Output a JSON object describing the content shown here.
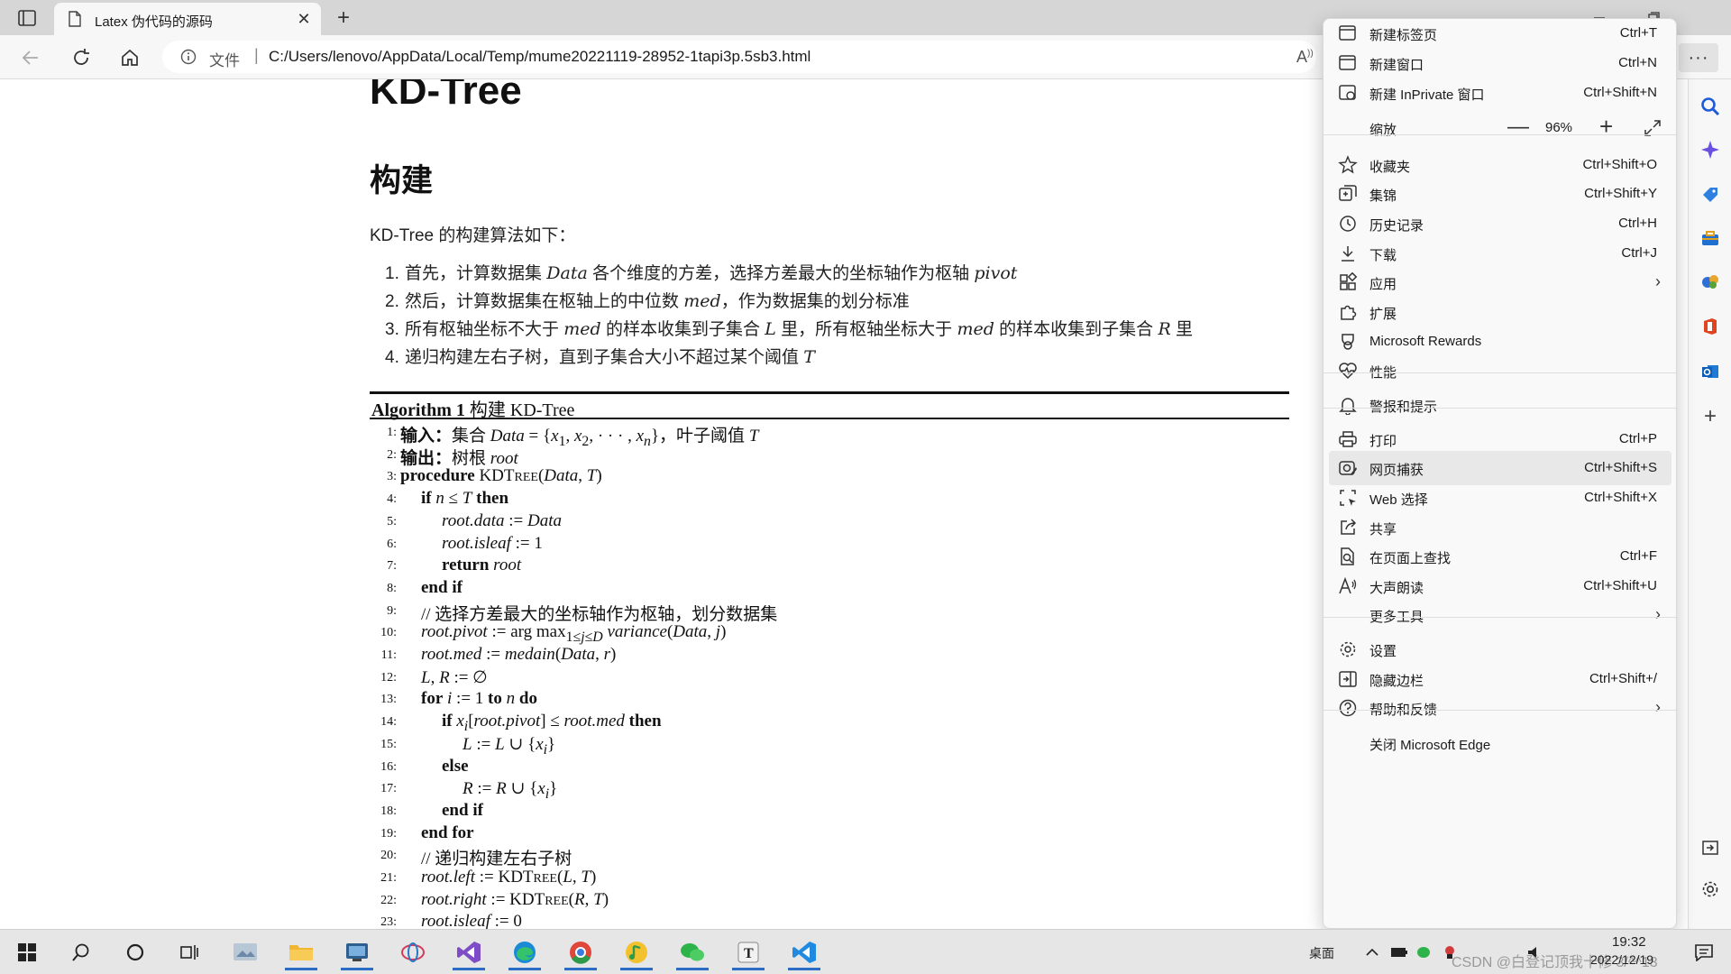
{
  "browser": {
    "tab": {
      "title": "Latex 伪代码的源码"
    },
    "address": {
      "label": "文件",
      "separator": "|",
      "url": "C:/Users/lenovo/AppData/Local/Temp/mume20221119-28952-1tapi3p.5sb3.html"
    },
    "more_label": "···"
  },
  "page": {
    "title": "KD-Tree",
    "section": "构建",
    "intro": "KD-Tree 的构建算法如下：",
    "steps": [
      {
        "num": "1.",
        "parts": [
          "首先，计算数据集 ",
          "Data",
          " 各个维度的方差，选择方差最大的坐标轴作为枢轴 ",
          "pivot",
          ""
        ]
      },
      {
        "num": "2.",
        "parts": [
          "然后，计算数据集在枢轴上的中位数 ",
          "med",
          "，作为数据集的划分标准",
          "",
          ""
        ]
      },
      {
        "num": "3.",
        "parts": [
          "所有枢轴坐标不大于 ",
          "med",
          " 的样本收集到子集合 ",
          "L",
          " 里，所有枢轴坐标大于 ",
          "med",
          " 的样本收集到子集合 ",
          "R",
          " 里"
        ]
      },
      {
        "num": "4.",
        "parts": [
          "递归构建左右子树，直到子集合大小不超过某个阈值 ",
          "T",
          ""
        ]
      }
    ],
    "algorithm": {
      "caption_bold": "Algorithm 1",
      "caption_text": " 构建 KD-Tree",
      "lines": [
        {
          "n": "1:",
          "indent": 0,
          "html": "<span class='kw'>输入：</span>集合 <i>Data</i> = {<i>x</i><sub>1</sub>, <i>x</i><sub>2</sub>, · · · , <i>x</i><sub><i>n</i></sub>}，叶子阈值 <i>T</i>"
        },
        {
          "n": "2:",
          "indent": 0,
          "html": "<span class='kw'>输出：</span>树根 <i>root</i>"
        },
        {
          "n": "3:",
          "indent": 0,
          "html": "<span class='kw'>procedure</span> KDT<span style='font-size:14px'>REE</span>(<i>Data</i>, <i>T</i>)"
        },
        {
          "n": "4:",
          "indent": 1,
          "html": "<span class='kw'>if</span> <i>n</i> ≤ <i>T</i> <span class='kw'>then</span>"
        },
        {
          "n": "5:",
          "indent": 2,
          "html": "<i>root.data</i> := <i>Data</i>"
        },
        {
          "n": "6:",
          "indent": 2,
          "html": "<i>root.isleaf</i> := 1"
        },
        {
          "n": "7:",
          "indent": 2,
          "html": "<span class='kw'>return</span> <i>root</i>"
        },
        {
          "n": "8:",
          "indent": 1,
          "html": "<span class='kw'>end if</span>"
        },
        {
          "n": "9:",
          "indent": 1,
          "html": "// 选择方差最大的坐标轴作为枢轴，划分数据集"
        },
        {
          "n": "10:",
          "indent": 1,
          "html": "<i>root.pivot</i> := arg max<sub>1≤<i>j</i>≤<i>D</i></sub> <i>variance</i>(<i>Data</i>, <i>j</i>)"
        },
        {
          "n": "11:",
          "indent": 1,
          "html": "<i>root.med</i> := <i>medain</i>(<i>Data</i>, <i>r</i>)"
        },
        {
          "n": "12:",
          "indent": 1,
          "html": "<i>L</i>, <i>R</i> := ∅"
        },
        {
          "n": "13:",
          "indent": 1,
          "html": "<span class='kw'>for</span> <i>i</i> := 1 <span class='kw'>to</span> <i>n</i> <span class='kw'>do</span>"
        },
        {
          "n": "14:",
          "indent": 2,
          "html": "<span class='kw'>if</span> <i>x</i><sub><i>i</i></sub>[<i>root.pivot</i>] ≤ <i>root.med</i> <span class='kw'>then</span>"
        },
        {
          "n": "15:",
          "indent": 3,
          "html": "<i>L</i> := <i>L</i> ∪ {<i>x</i><sub><i>i</i></sub>}"
        },
        {
          "n": "16:",
          "indent": 2,
          "html": "<span class='kw'>else</span>"
        },
        {
          "n": "17:",
          "indent": 3,
          "html": "<i>R</i> := <i>R</i> ∪ {<i>x</i><sub><i>i</i></sub>}"
        },
        {
          "n": "18:",
          "indent": 2,
          "html": "<span class='kw'>end if</span>"
        },
        {
          "n": "19:",
          "indent": 1,
          "html": "<span class='kw'>end for</span>"
        },
        {
          "n": "20:",
          "indent": 1,
          "html": "// 递归构建左右子树"
        },
        {
          "n": "21:",
          "indent": 1,
          "html": "<i>root.left</i> := KDT<span style='font-size:14px'>REE</span>(<i>L</i>, <i>T</i>)"
        },
        {
          "n": "22:",
          "indent": 1,
          "html": "<i>root.right</i> := KDT<span style='font-size:14px'>REE</span>(<i>R</i>, <i>T</i>)"
        },
        {
          "n": "23:",
          "indent": 1,
          "html": "<i>root.isleaf</i> := 0"
        }
      ]
    }
  },
  "menu": {
    "items": [
      {
        "name": "new-tab",
        "icon": "newtab-icon",
        "label": "新建标签页",
        "shortcut": "Ctrl+T"
      },
      {
        "name": "new-window",
        "icon": "window-icon",
        "label": "新建窗口",
        "shortcut": "Ctrl+N"
      },
      {
        "name": "new-inprivate",
        "icon": "inprivate-icon",
        "label": "新建 InPrivate 窗口",
        "shortcut": "Ctrl+Shift+N"
      },
      {
        "name": "zoom",
        "label": "缩放",
        "zoom_value": "96%",
        "minus": "—",
        "plus": "+"
      },
      {
        "name": "favorites",
        "icon": "star-icon",
        "label": "收藏夹",
        "shortcut": "Ctrl+Shift+O"
      },
      {
        "name": "collections",
        "icon": "collections-icon",
        "label": "集锦",
        "shortcut": "Ctrl+Shift+Y"
      },
      {
        "name": "history",
        "icon": "history-icon",
        "label": "历史记录",
        "shortcut": "Ctrl+H"
      },
      {
        "name": "downloads",
        "icon": "download-icon",
        "label": "下载",
        "shortcut": "Ctrl+J"
      },
      {
        "name": "apps",
        "icon": "apps-icon",
        "label": "应用",
        "chevron": "›"
      },
      {
        "name": "extensions",
        "icon": "puzzle-icon",
        "label": "扩展"
      },
      {
        "name": "rewards",
        "icon": "rewards-icon",
        "label": "Microsoft Rewards"
      },
      {
        "name": "performance",
        "icon": "heartbeat-icon",
        "label": "性能"
      },
      {
        "name": "alerts",
        "icon": "bell-icon",
        "label": "警报和提示"
      },
      {
        "name": "print",
        "icon": "printer-icon",
        "label": "打印",
        "shortcut": "Ctrl+P"
      },
      {
        "name": "web-capture",
        "icon": "capture-icon",
        "label": "网页捕获",
        "shortcut": "Ctrl+Shift+S"
      },
      {
        "name": "web-select",
        "icon": "select-icon",
        "label": "Web 选择",
        "shortcut": "Ctrl+Shift+X"
      },
      {
        "name": "share",
        "icon": "share-icon",
        "label": "共享"
      },
      {
        "name": "find-on-page",
        "icon": "find-icon",
        "label": "在页面上查找",
        "shortcut": "Ctrl+F"
      },
      {
        "name": "read-aloud",
        "icon": "read-aloud-icon",
        "label": "大声朗读",
        "shortcut": "Ctrl+Shift+U"
      },
      {
        "name": "more-tools",
        "label": "更多工具",
        "chevron": "›"
      },
      {
        "name": "settings",
        "icon": "gear-icon",
        "label": "设置"
      },
      {
        "name": "hide-sidebar",
        "icon": "sidebar-icon",
        "label": "隐藏边栏",
        "shortcut": "Ctrl+Shift+/"
      },
      {
        "name": "help",
        "icon": "help-icon",
        "label": "帮助和反馈",
        "chevron": "›"
      },
      {
        "name": "close-edge",
        "label": "关闭 Microsoft Edge"
      }
    ]
  },
  "taskbar": {
    "desktop_label": "桌面",
    "time": "19:32",
    "date": "2022/12/19",
    "watermark": "CSDN @白登记顶我十修 3/^^13"
  },
  "colors": {
    "accent": "#2b6cc4",
    "menu_bg": "#f9f9f9",
    "tab_strip": "#d6d6d6"
  }
}
